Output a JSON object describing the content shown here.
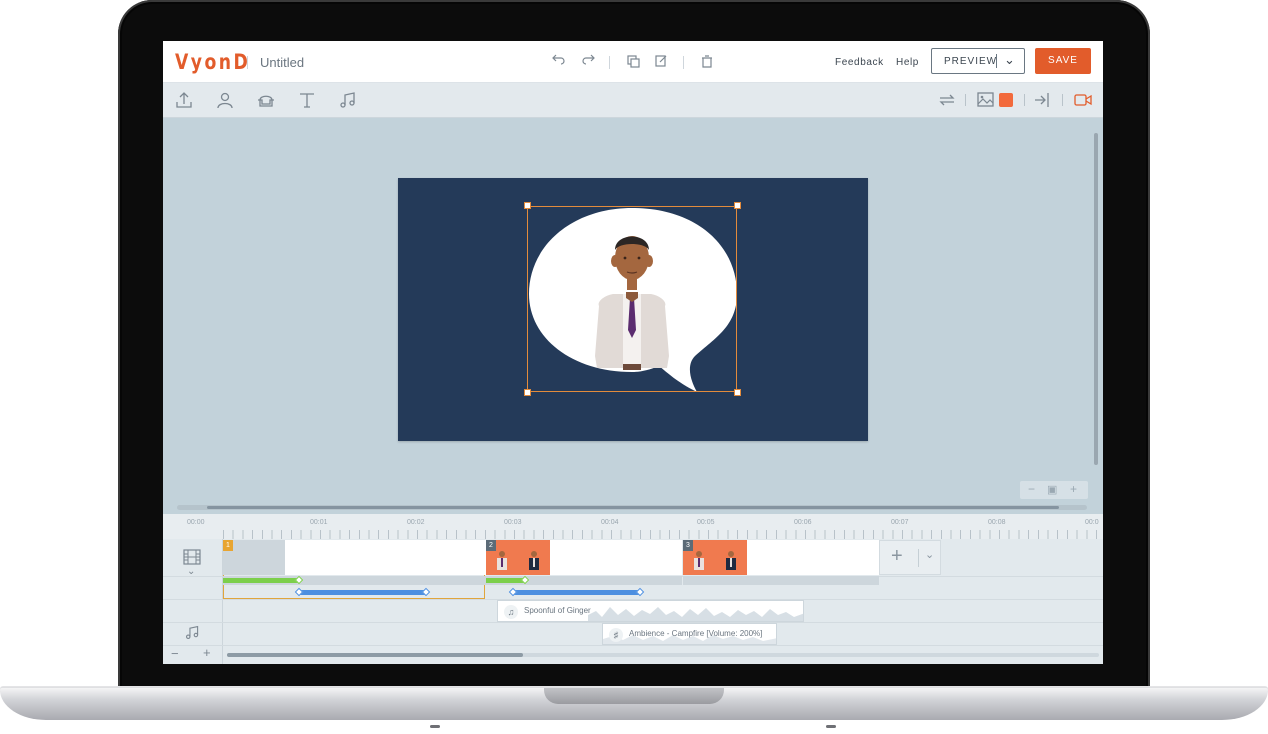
{
  "app": {
    "logo": "VyonD",
    "project_title": "Untitled"
  },
  "header": {
    "feedback": "Feedback",
    "help": "Help",
    "preview": "PREVIEW",
    "save": "SAVE"
  },
  "timeline": {
    "ruler": [
      "00:00",
      "00:01",
      "00:02",
      "00:03",
      "00:04",
      "00:05",
      "00:06",
      "00:07",
      "00:08",
      "00:0"
    ],
    "scenes": [
      "1",
      "2",
      "3"
    ],
    "audio_tracks": [
      "Spoonful of Ginger",
      "Ambience - Campfire [Volume: 200%]"
    ]
  },
  "colors": {
    "brand": "#e25c2b",
    "canvas": "#243a59",
    "selection": "#e38b3c",
    "motion_green": "#7ccf4b",
    "motion_blue": "#4d8fe0"
  }
}
